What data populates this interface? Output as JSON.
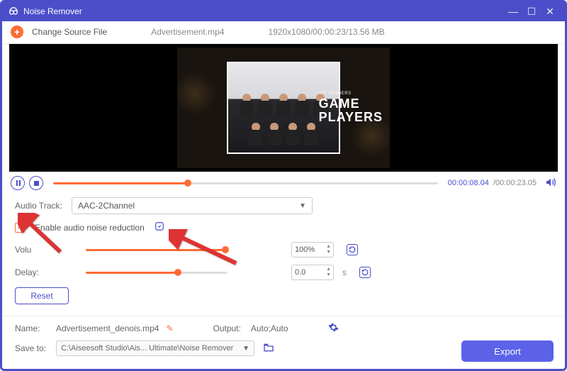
{
  "titlebar": {
    "title": "Noise Remover"
  },
  "toolbar": {
    "change_source": "Change Source File",
    "filename": "Advertisement.mp4",
    "info": "1920x1080/00:00:23/13.56 MB"
  },
  "video_overlay": {
    "subtitle": "ATT LEADERS",
    "line1": "GAME",
    "line2": "PLAYERS"
  },
  "player": {
    "current_time": "00:00:08.04",
    "total_time": "/00:00:23.05",
    "seek_position_pct": 35
  },
  "panel": {
    "audio_track_label": "Audio Track:",
    "audio_track_value": "AAC-2Channel",
    "enable_noise_label": "Enable audio noise reduction",
    "volume_label": "Volu",
    "volume_value": "100%",
    "delay_label": "Delay:",
    "delay_value": "0.0",
    "delay_unit": "s",
    "reset_label": "Reset"
  },
  "output": {
    "name_label": "Name:",
    "name_value": "Advertisement_denois.mp4",
    "output_label": "Output:",
    "output_value": "Auto;Auto",
    "saveto_label": "Save to:",
    "saveto_value": "C:\\Aiseesoft Studio\\Ais... Ultimate\\Noise Remover",
    "export_label": "Export"
  }
}
